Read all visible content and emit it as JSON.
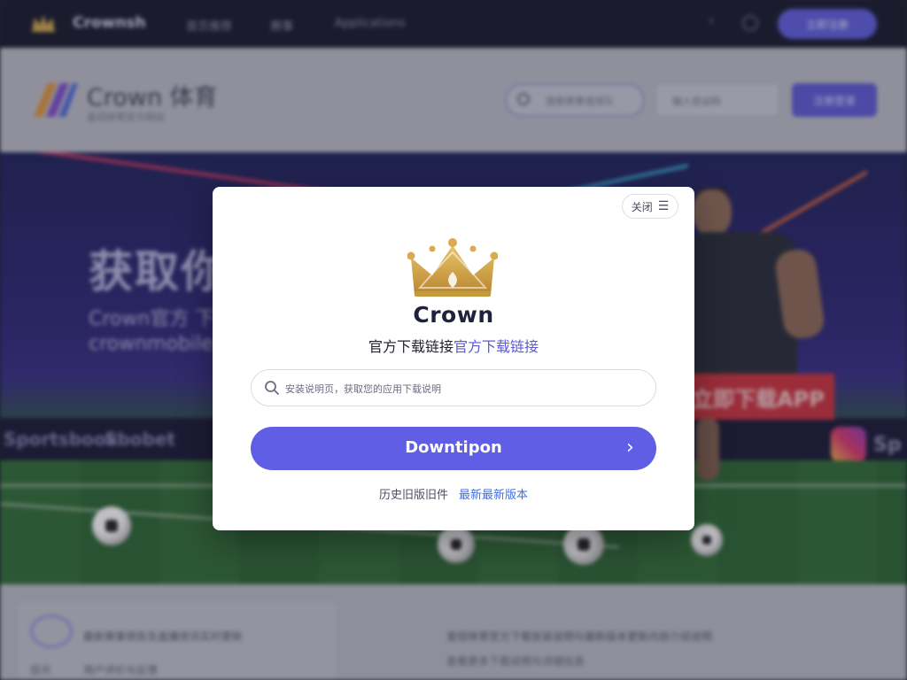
{
  "background": {
    "topbar": {
      "brand": "Crownsh",
      "nav": [
        "首页推荐",
        "赛事",
        "Applications"
      ],
      "button_label": "立即注册"
    },
    "header": {
      "logo_text": "Crown 体育",
      "logo_subtitle": "皇冠体育官方网站",
      "search_placeholder": "搜索赛事或球队",
      "box_text": "输入验证码",
      "button_label": "注册登录"
    },
    "hero": {
      "title": "获取你",
      "line1": "Crown官方 下载 ",
      "line2": "crownmobile",
      "ad_texts": [
        "Sportsbook",
        "Sbobet"
      ],
      "red_banner": "立即下载APP",
      "social": "Sp"
    },
    "bottom": {
      "text1": "最新赛事预告及直播资讯实时更新",
      "text2": "用户评价与反馈",
      "text3": "皇冠体育官方下载安装说明与最新版本更新内容介绍说明",
      "text4": "查看更多下载说明与详细信息",
      "text5": "服务"
    }
  },
  "modal": {
    "close_label": "关闭",
    "brand": "Crown",
    "tagline_main": "官方下载链接",
    "tagline_accent": "官方下载链接",
    "search_placeholder": "安装说明页，获取您的应用下载说明",
    "download_label": "Downtipon",
    "footer_text": "历史旧版旧件",
    "footer_link": "最新最新版本"
  },
  "colors": {
    "accent": "#5f5ee4",
    "brand_dark": "#20223d",
    "link": "#3f6fe0",
    "gold": "#d4a84a"
  },
  "icons": {
    "close_menu": "menu-icon",
    "search": "search-icon",
    "chevron": "chevron-right-icon",
    "crown": "crown-logo-icon"
  }
}
